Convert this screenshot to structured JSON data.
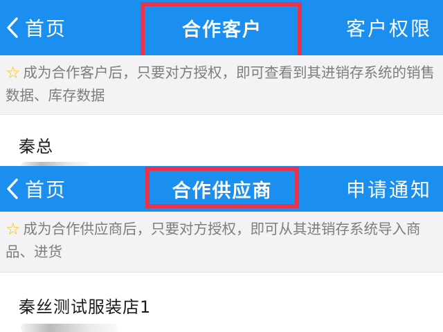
{
  "screens": [
    {
      "back_label": "首页",
      "title": "合作客户",
      "right_action": "客户权限",
      "notice": "成为合作客户后，只要对方授权，即可查看到其进销存系统的销售数据、库存数据",
      "notice_icon": "star-outline-icon",
      "items": [
        {
          "name": "秦总"
        }
      ]
    },
    {
      "back_label": "首页",
      "title": "合作供应商",
      "right_action": "申请通知",
      "notice": "成为合作供应商后，只要对方授权，即可从其进销存系统导入商品、进货",
      "notice_icon": "star-outline-icon",
      "items": [
        {
          "name": "秦丝测试服装店1"
        }
      ]
    }
  ],
  "colors": {
    "navbar": "#1a8ff0",
    "highlight": "#e8334a",
    "notice_bg": "#f3f3f5",
    "star": "#f5c400"
  }
}
